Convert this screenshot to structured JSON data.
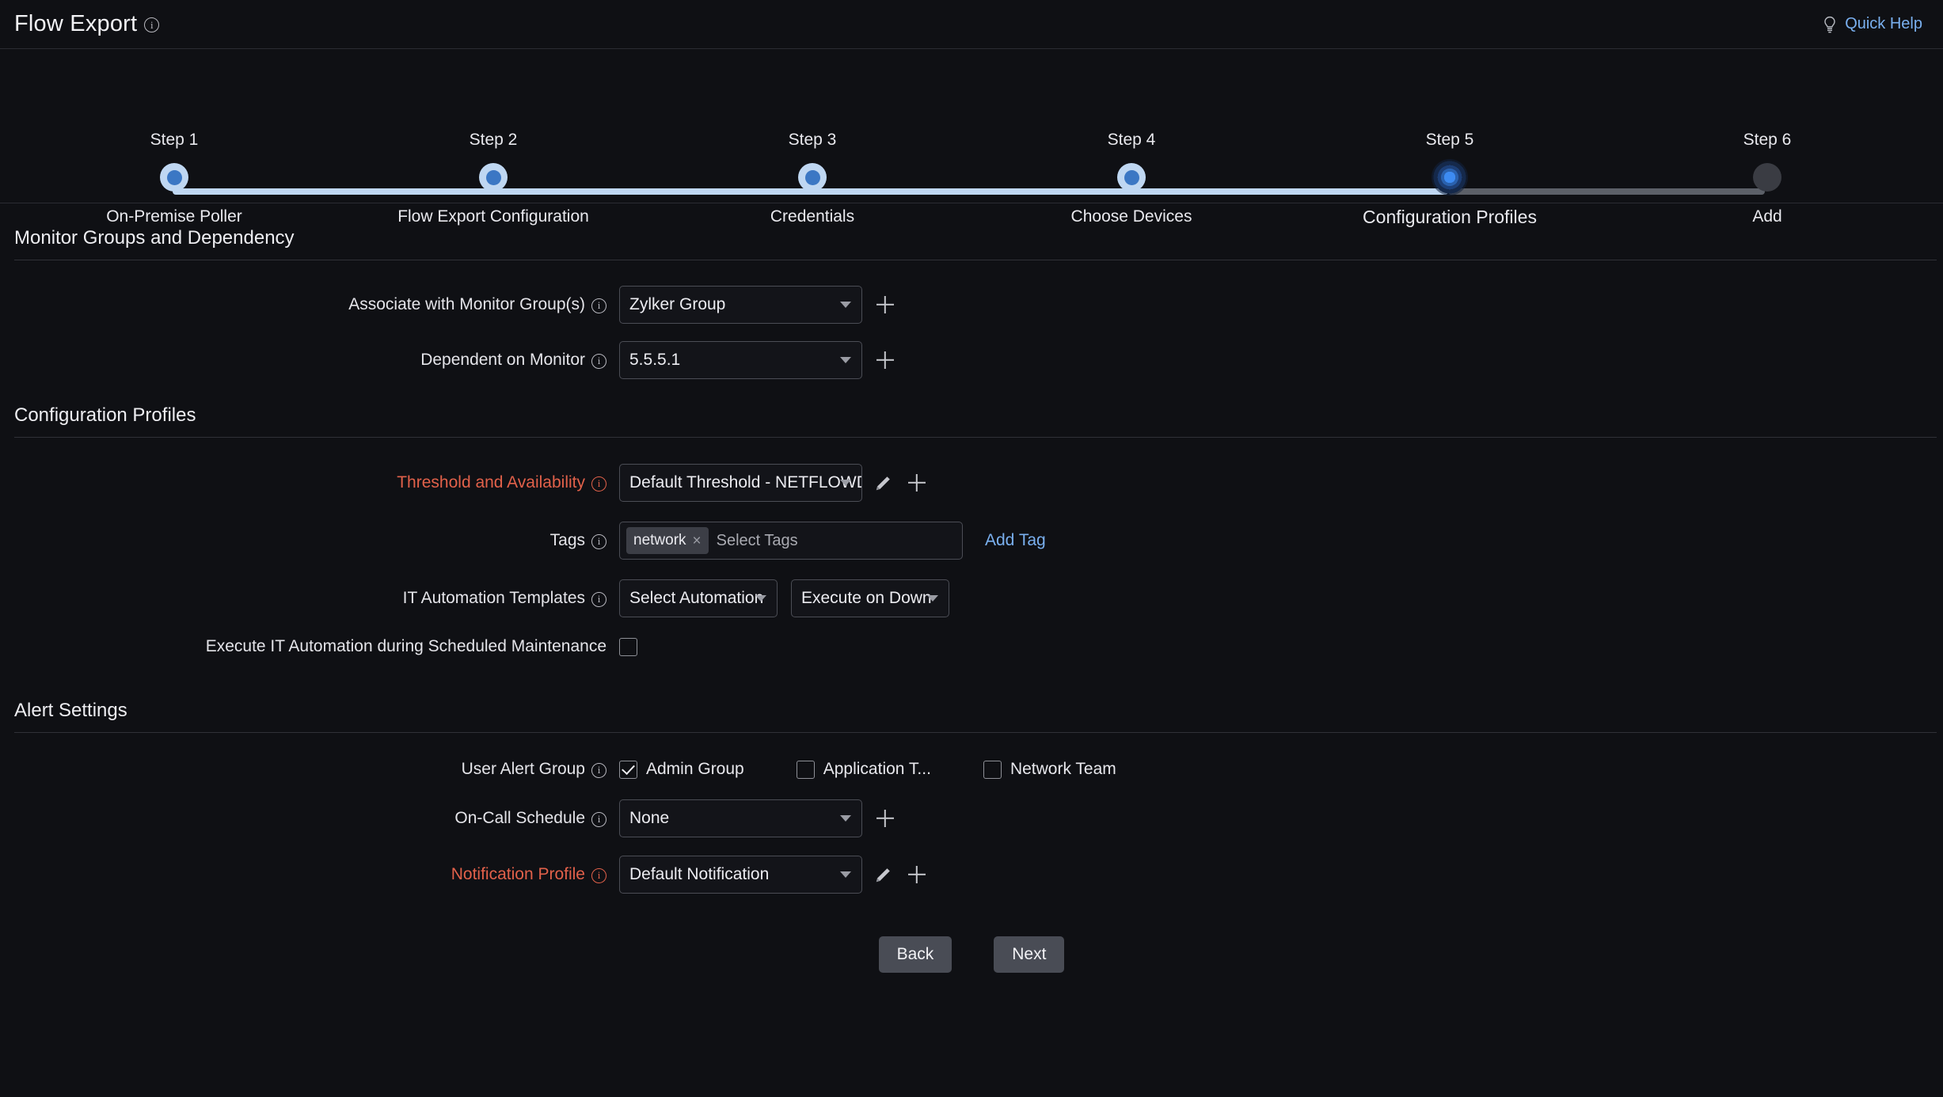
{
  "header": {
    "title": "Flow Export",
    "info_icon": "info-icon",
    "quick_help": "Quick Help",
    "quick_help_icon": "lightbulb-icon",
    "accent_link_color": "#7ab0f0"
  },
  "stepper": {
    "steps": [
      {
        "num": "Step 1",
        "label": "On-Premise Poller",
        "state": "done"
      },
      {
        "num": "Step 2",
        "label": "Flow Export Configuration",
        "state": "done"
      },
      {
        "num": "Step 3",
        "label": "Credentials",
        "state": "done"
      },
      {
        "num": "Step 4",
        "label": "Choose Devices",
        "state": "done"
      },
      {
        "num": "Step 5",
        "label": "Configuration Profiles",
        "state": "current"
      },
      {
        "num": "Step 6",
        "label": "Add",
        "state": "todo"
      }
    ],
    "done_color": "#bfd7f2",
    "current_color": "#3d8bf2",
    "todo_color": "#3a3c43"
  },
  "sections": {
    "monitor_groups": {
      "title": "Monitor Groups and Dependency",
      "associate_label": "Associate with Monitor Group(s)",
      "associate_value": "Zylker Group",
      "dependent_label": "Dependent on Monitor",
      "dependent_value": "5.5.5.1"
    },
    "configuration_profiles": {
      "title": "Configuration Profiles",
      "threshold_label": "Threshold and Availability",
      "threshold_value": "Default Threshold - NETFLOWDEVICE",
      "threshold_required_color": "#e2614a",
      "tags_label": "Tags",
      "tag_chips": [
        "network"
      ],
      "tags_placeholder": "Select Tags",
      "add_tag_label": "Add Tag",
      "automation_label": "IT Automation Templates",
      "automation_value": "Select Automation",
      "automation_trigger_value": "Execute on Down",
      "maintenance_label": "Execute IT Automation during Scheduled Maintenance",
      "maintenance_checked": false
    },
    "alert_settings": {
      "title": "Alert Settings",
      "user_alert_group_label": "User Alert Group",
      "user_alert_groups": [
        {
          "label": "Admin Group",
          "checked": true
        },
        {
          "label": "Application T...",
          "checked": false
        },
        {
          "label": "Network Team",
          "checked": false
        }
      ],
      "oncall_label": "On-Call Schedule",
      "oncall_value": "None",
      "notification_label": "Notification Profile",
      "notification_value": "Default Notification",
      "notification_required_color": "#e2614a"
    }
  },
  "footer": {
    "back_label": "Back",
    "next_label": "Next"
  }
}
